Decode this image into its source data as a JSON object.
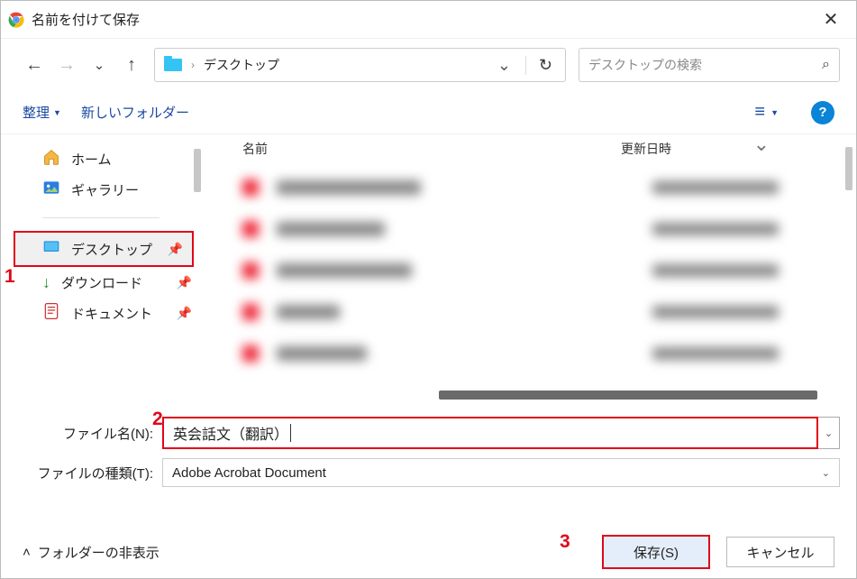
{
  "window": {
    "title": "名前を付けて保存"
  },
  "address": {
    "breadcrumb_current": "デスクトップ",
    "search_placeholder": "デスクトップの検索"
  },
  "toolbar": {
    "organize": "整理",
    "new_folder": "新しいフォルダー"
  },
  "sidebar": {
    "home": "ホーム",
    "gallery": "ギャラリー",
    "desktop": "デスクトップ",
    "downloads": "ダウンロード",
    "documents": "ドキュメント"
  },
  "file_header": {
    "name": "名前",
    "date": "更新日時"
  },
  "form": {
    "filename_label": "ファイル名(N):",
    "filename_value": "英会話文（翻訳）",
    "filetype_label": "ファイルの種類(T):",
    "filetype_value": "Adobe Acrobat Document"
  },
  "bottom": {
    "folder_toggle": "フォルダーの非表示",
    "save": "保存(S)",
    "cancel": "キャンセル"
  },
  "annotations": {
    "n1": "1",
    "n2": "2",
    "n3": "3"
  }
}
